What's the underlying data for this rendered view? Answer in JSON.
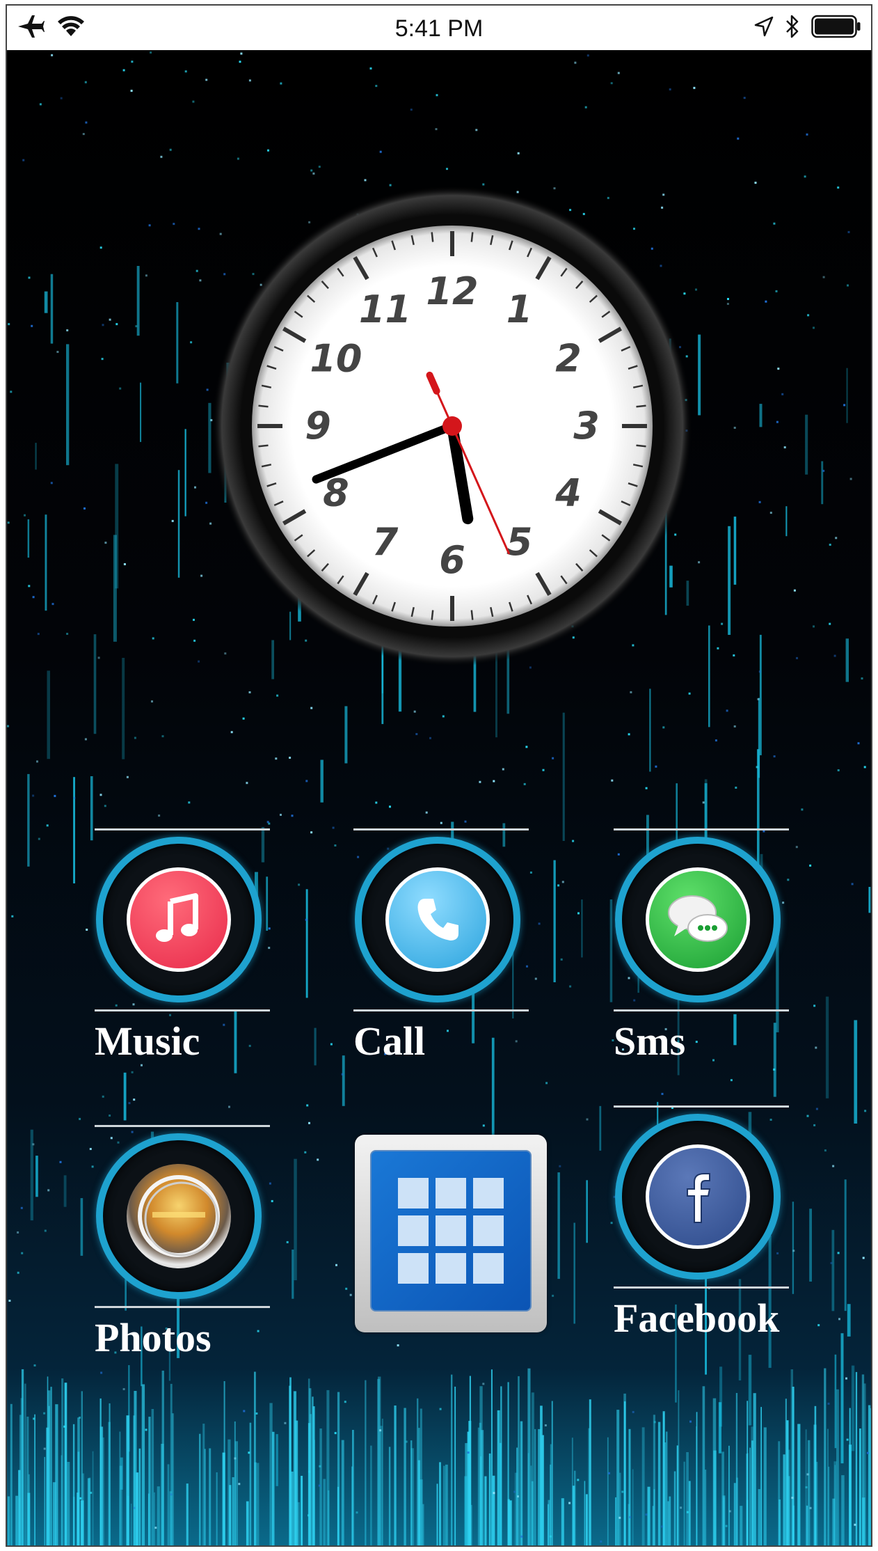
{
  "status_bar": {
    "time": "5:41 PM",
    "left_icons": [
      "airplane-icon",
      "wifi-icon"
    ],
    "right_icons": [
      "location-arrow-icon",
      "bluetooth-icon",
      "battery-icon"
    ]
  },
  "clock": {
    "numerals": [
      "12",
      "1",
      "2",
      "3",
      "4",
      "5",
      "6",
      "7",
      "8",
      "9",
      "10",
      "11"
    ],
    "time": {
      "hour": 5,
      "minute": 41,
      "second": 26
    },
    "colors": {
      "face": "#ffffff",
      "hands": "#000000",
      "second_hand": "#d4161b",
      "numerals": "#444444"
    }
  },
  "apps": [
    {
      "label": "Music",
      "icon": "music-note-icon",
      "color": "#f2425a"
    },
    {
      "label": "Call",
      "icon": "phone-icon",
      "color": "#3ab0e6"
    },
    {
      "label": "Sms",
      "icon": "chat-bubble-icon",
      "color": "#29b340"
    },
    {
      "label": "Photos",
      "icon": "photos-stack-icon",
      "color": "#c9a35a"
    },
    {
      "label": "",
      "icon": "app-grid-icon",
      "color": "#0b63c6"
    },
    {
      "label": "Facebook",
      "icon": "facebook-icon",
      "color": "#3b5998"
    }
  ],
  "colors": {
    "ring": "#1ea2cf",
    "accent": "#19c3e6"
  }
}
